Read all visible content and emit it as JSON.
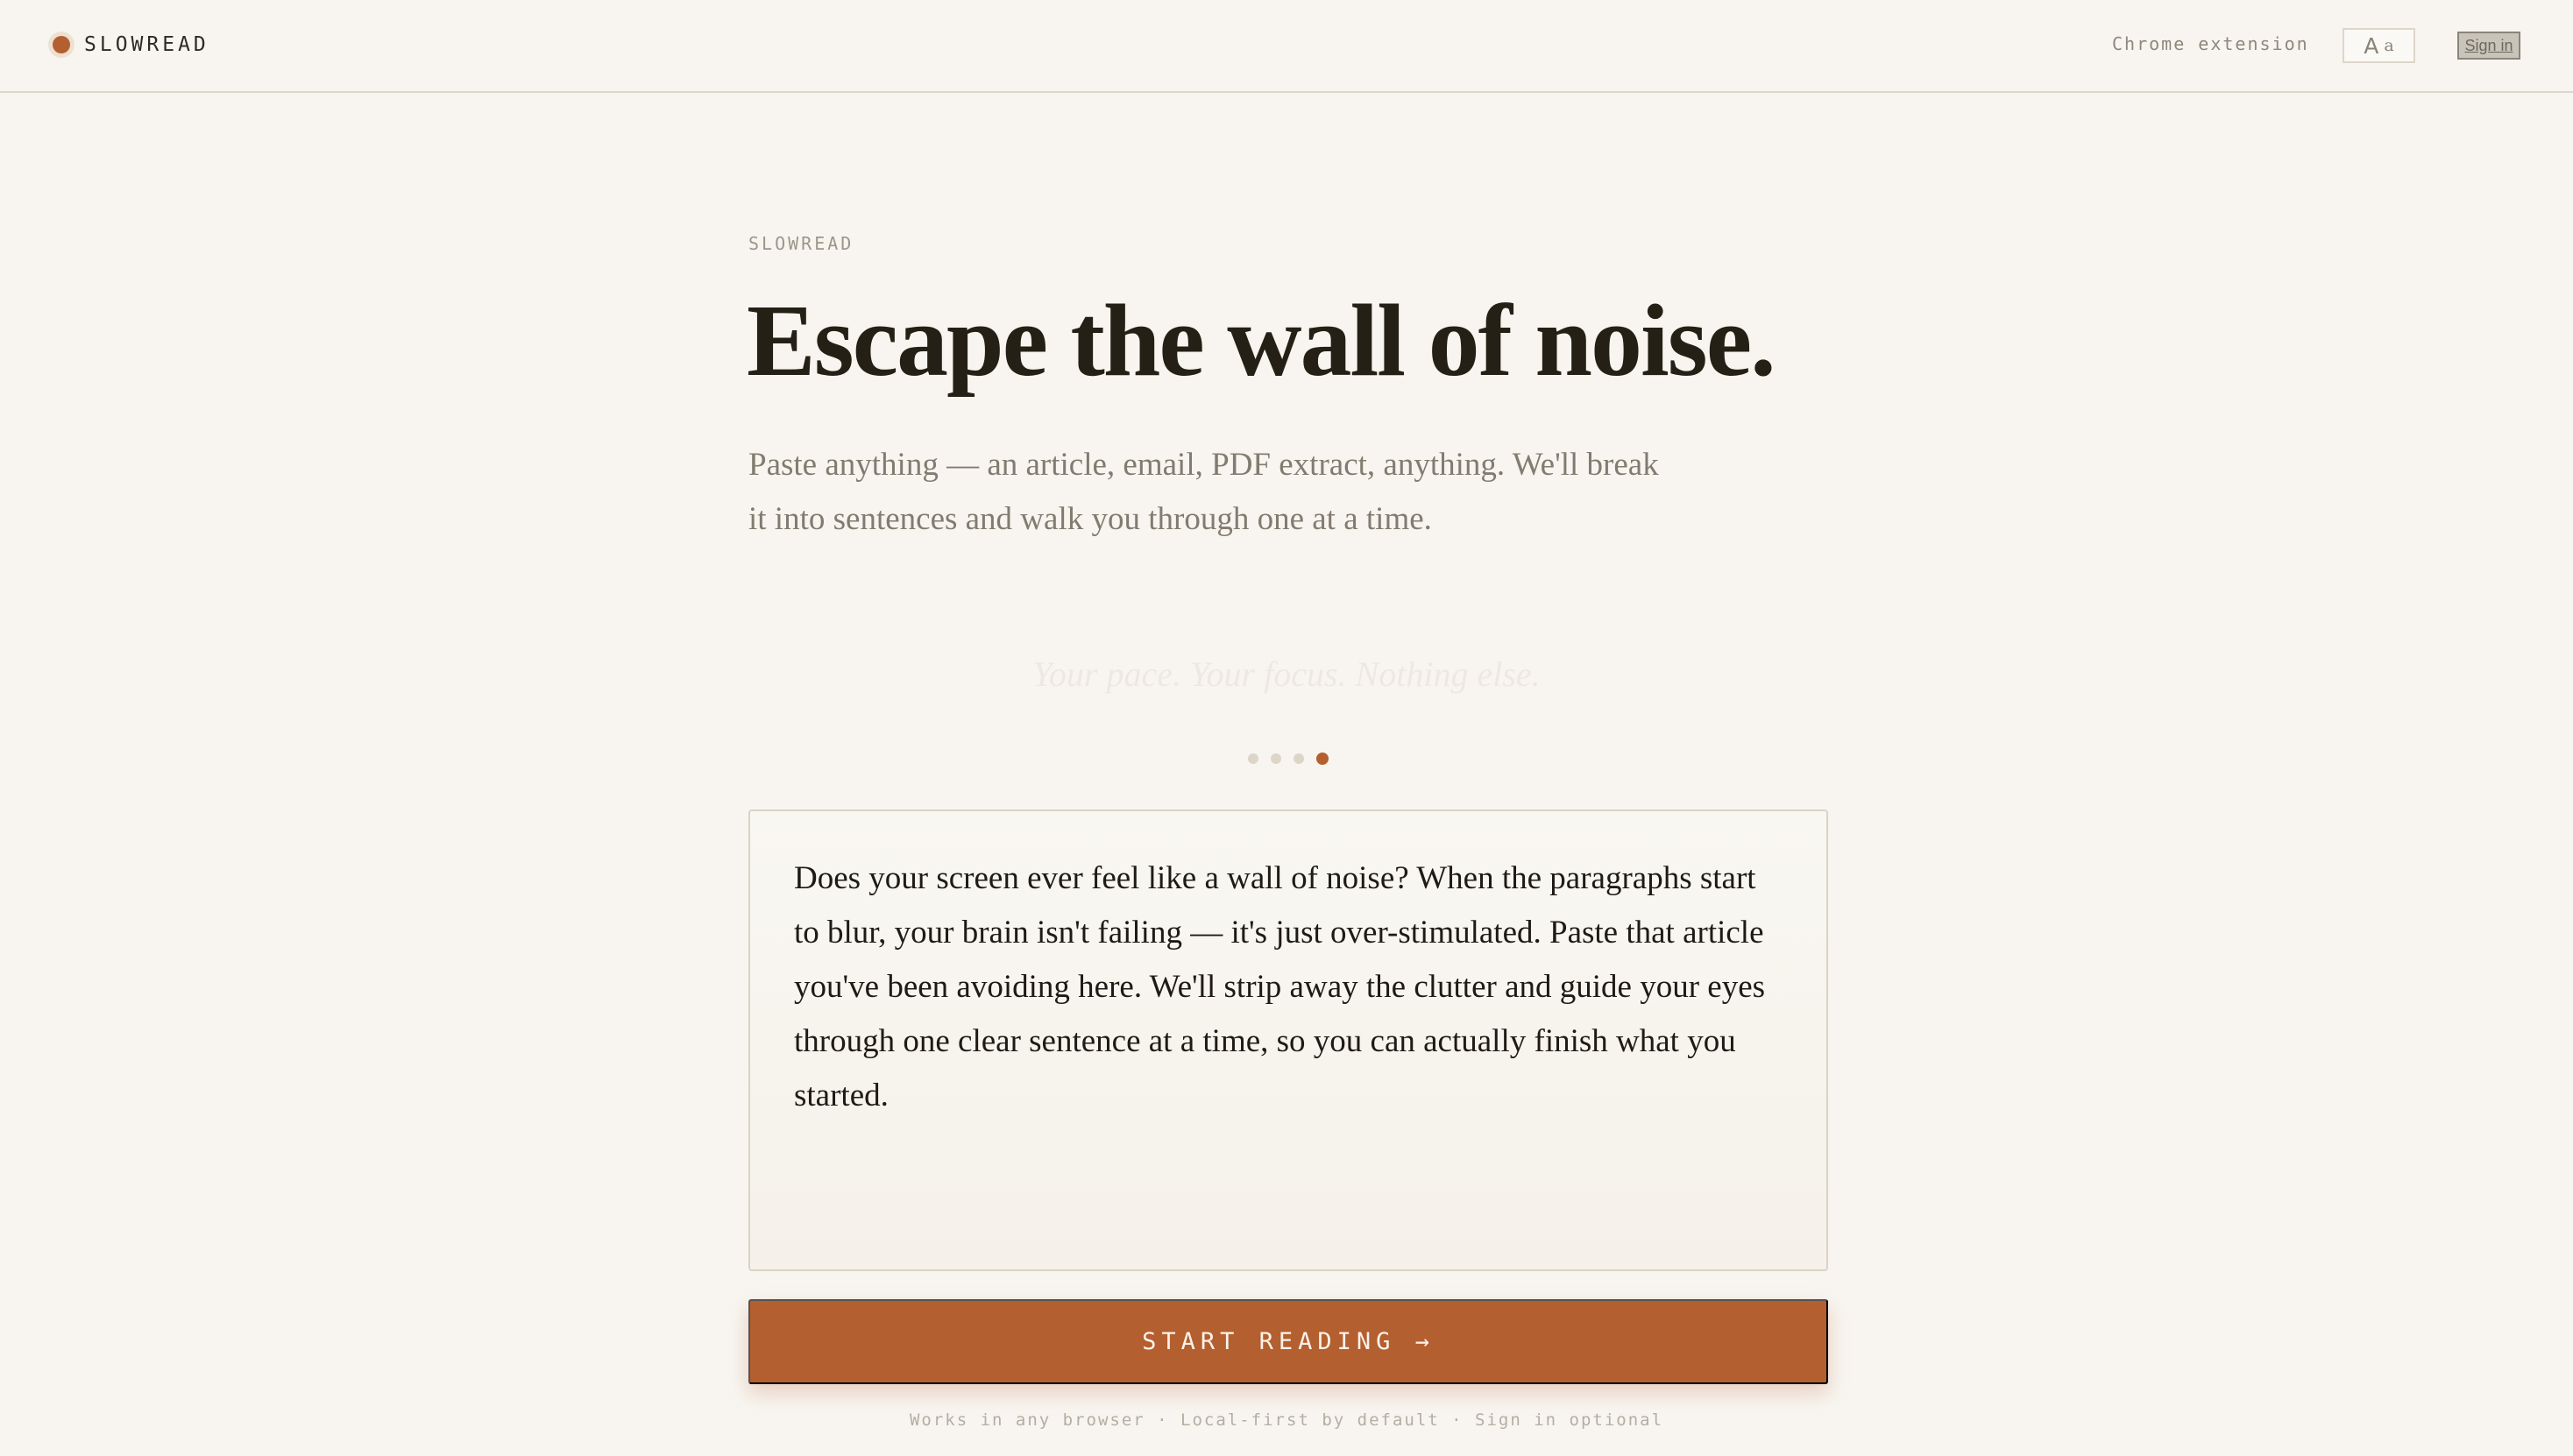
{
  "header": {
    "brand": "SLOWREAD",
    "nav_link": "Chrome extension",
    "font_toggle_large": "A",
    "font_toggle_small": "a",
    "signin": "Sign in"
  },
  "hero": {
    "eyebrow": "SLOWREAD",
    "headline": "Escape the wall of noise.",
    "subtext": "Paste anything — an article, email, PDF extract, anything. We'll break it into sentences and walk you through one at a time.",
    "tagline": "Your pace. Your focus. Nothing else."
  },
  "carousel": {
    "count": 4,
    "active_index": 3
  },
  "paste_box": {
    "value": "Does your screen ever feel like a wall of noise? When the paragraphs start to blur, your brain isn't failing — it's just over-stimulated. Paste that article you've been avoiding here. We'll strip away the clutter and guide your eyes through one clear sentence at a time, so you can actually finish what you started."
  },
  "cta": {
    "label": "START READING →"
  },
  "footnote": "Works in any browser · Local-first by default · Sign in optional",
  "colors": {
    "accent": "#b45f2f",
    "background": "#f8f5f0",
    "text": "#242015"
  }
}
